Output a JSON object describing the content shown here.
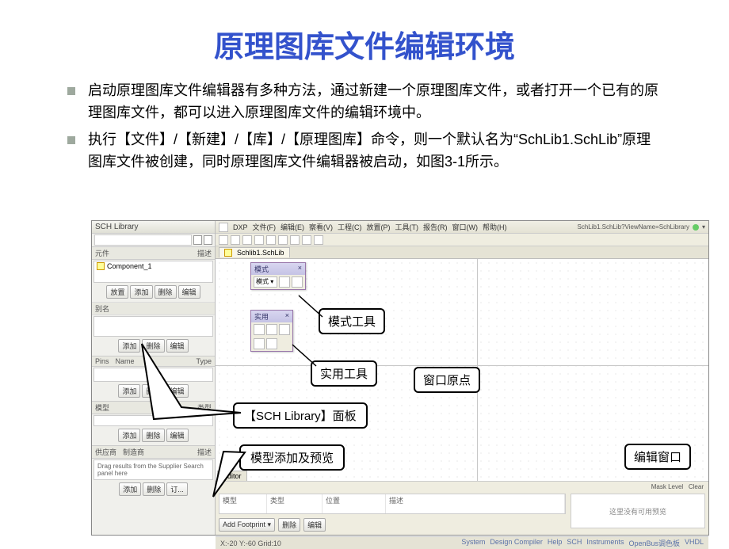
{
  "title": "原理图库文件编辑环境",
  "bullets": [
    "启动原理图库文件编辑器有多种方法，通过新建一个原理图库文件，或者打开一个已有的原理图库文件，都可以进入原理图库文件的编辑环境中。",
    "执行【文件】/【新建】/【库】/【原理图库】命令，则一个默认名为“SchLib1.SchLib”原理图库文件被创建，同时原理图库文件编辑器被启动，如图3-1所示。"
  ],
  "panel": {
    "title": "SCH Library",
    "search_placeholder": "",
    "cols": {
      "c1": "元件",
      "c2": "描述"
    },
    "item": "Component_1",
    "btns_main": [
      "放置",
      "添加",
      "删除",
      "编辑"
    ],
    "alias_hdr": "别名",
    "alias_btns": [
      "添加",
      "删除",
      "编辑"
    ],
    "pins_cols": {
      "a": "Pins",
      "b": "Name",
      "c": "Type"
    },
    "pins_btns": [
      "添加",
      "删除",
      "编辑"
    ],
    "model_cols": {
      "a": "模型",
      "b": "类型"
    },
    "model_btns": [
      "添加",
      "删除",
      "编辑"
    ],
    "supplier_hdr": {
      "a": "供应商",
      "b": "制造商",
      "c": "描述"
    },
    "supplier_note": "Drag results from the Supplier Search panel here",
    "supplier_btns": [
      "添加",
      "删除",
      "订..."
    ]
  },
  "menu": {
    "items": [
      "DXP",
      "文件(F)",
      "编辑(E)",
      "察看(V)",
      "工程(C)",
      "放置(P)",
      "工具(T)",
      "报告(R)",
      "窗口(W)",
      "帮助(H)"
    ],
    "right_path": "SchLib1.SchLib?ViewName=SchLibrary"
  },
  "doc_tab": "Schlib1.SchLib",
  "float": {
    "mode_title": "模式",
    "mode_sel": "模式 ▾",
    "util_title": "实用"
  },
  "callouts": {
    "mode": "模式工具",
    "util": "实用工具",
    "origin": "窗口原点",
    "panel": "【SCH Library】面板",
    "preview": "模型添加及预览",
    "editwin": "编辑窗口"
  },
  "bottom": {
    "editor_tab": "Editor",
    "mask": "Mask Level",
    "clear": "Clear",
    "grid_cols": [
      "模型",
      "类型",
      "位置",
      "描述"
    ],
    "preview_text": "这里没有可用预览",
    "btns": [
      "Add Footprint ▾",
      "删除",
      "编辑"
    ]
  },
  "status": {
    "left": "X:-20 Y:-60  Grid:10",
    "right": [
      "System",
      "Design Compiler",
      "Help",
      "SCH",
      "Instruments",
      "OpenBus调色板",
      "VHDL"
    ]
  }
}
